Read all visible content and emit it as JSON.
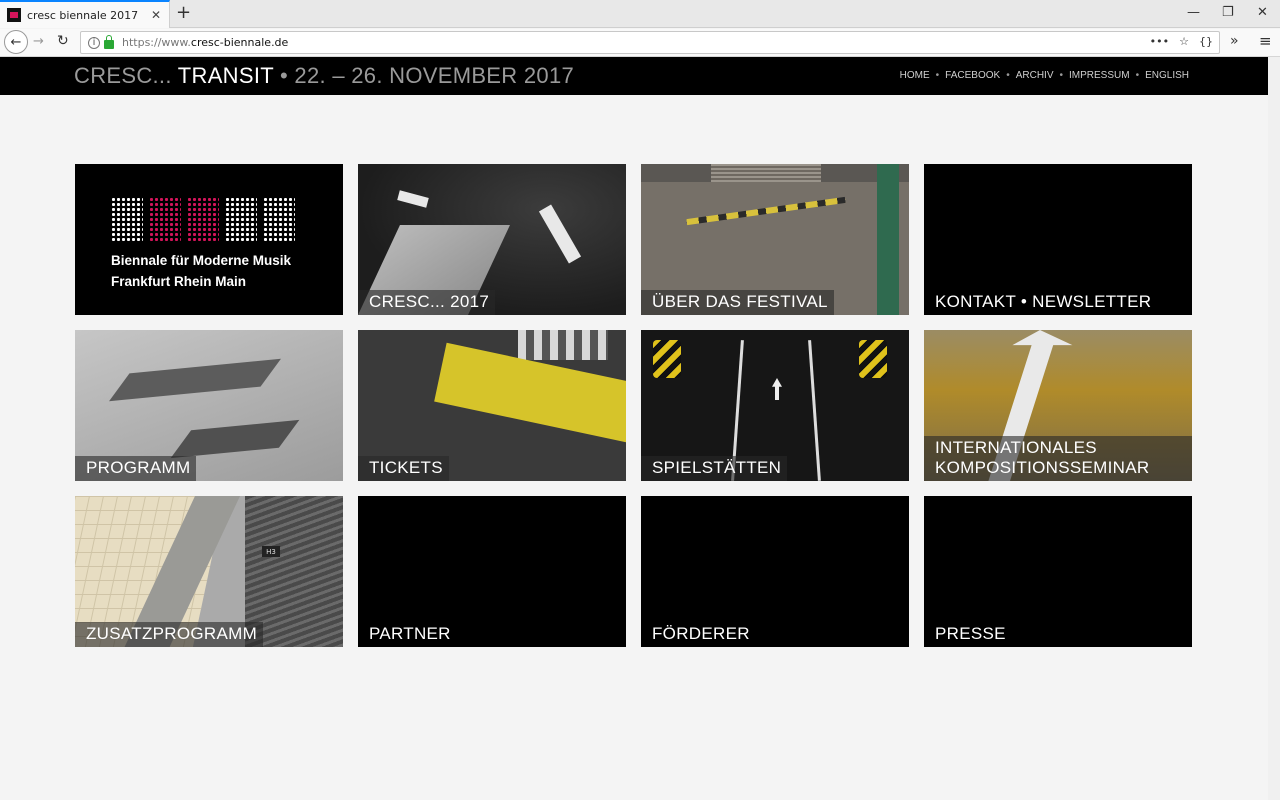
{
  "browser": {
    "tab_title": "cresc biennale 2017",
    "tab_close": "✕",
    "new_tab": "+",
    "url_prefix": "https://www.",
    "url_domain": "cresc-biennale.de",
    "url_actions": [
      "•••",
      "☆",
      "{}"
    ],
    "window_controls": [
      "—",
      "❐",
      "✕"
    ],
    "overflow": "»",
    "menu": "≡"
  },
  "header": {
    "title_prefix": "CRESC... ",
    "title_highlight": "TRANSIT",
    "title_suffix": " • 22. – 26. NOVEMBER 2017",
    "nav": [
      "HOME",
      "FACEBOOK",
      "ARCHIV",
      "IMPRESSUM",
      "ENGLISH"
    ],
    "nav_separator": "•"
  },
  "logo": {
    "line1": "Biennale für Moderne Musik",
    "line2": "Frankfurt Rhein Main"
  },
  "tiles": [
    {
      "label": "CRESC... 2017"
    },
    {
      "label": "ÜBER DAS FESTIVAL"
    },
    {
      "label": "KONTAKT • NEWSLETTER"
    },
    {
      "label": "PROGRAMM"
    },
    {
      "label": "TICKETS"
    },
    {
      "label": "SPIELSTÄTTEN"
    },
    {
      "label": "INTERNATIONALES KOMPOSITIONSSEMINAR"
    },
    {
      "label": "ZUSATZPROGRAMM"
    },
    {
      "label": "PARTNER"
    },
    {
      "label": "FÖRDERER"
    },
    {
      "label": "PRESSE"
    }
  ],
  "colors": {
    "brand_pink": "#d4145a",
    "header_bg": "#000000",
    "page_bg": "#f4f4f4"
  },
  "track_sign": "H3"
}
